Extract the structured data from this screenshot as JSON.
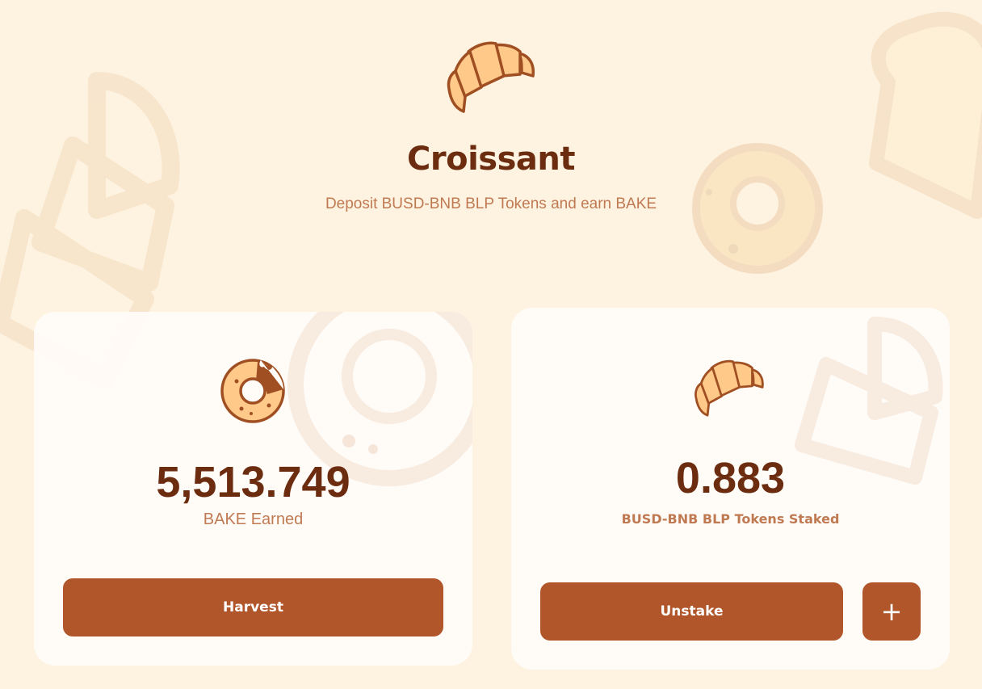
{
  "hero": {
    "icon": "croissant-icon",
    "title": "Croissant",
    "subtitle": "Deposit BUSD-BNB BLP Tokens and earn BAKE"
  },
  "earned_card": {
    "icon": "donut-icon",
    "value": "5,513.749",
    "label": "BAKE Earned",
    "harvest_label": "Harvest"
  },
  "staked_card": {
    "icon": "croissant-icon",
    "value": "0.883",
    "label": "BUSD-BNB BLP Tokens Staked",
    "unstake_label": "Unstake",
    "add_label": "+"
  },
  "colors": {
    "background": "#fef2e0",
    "title": "#6b2c0f",
    "muted": "#c07a52",
    "button": "#b1562a",
    "card": "#fffcf8"
  }
}
